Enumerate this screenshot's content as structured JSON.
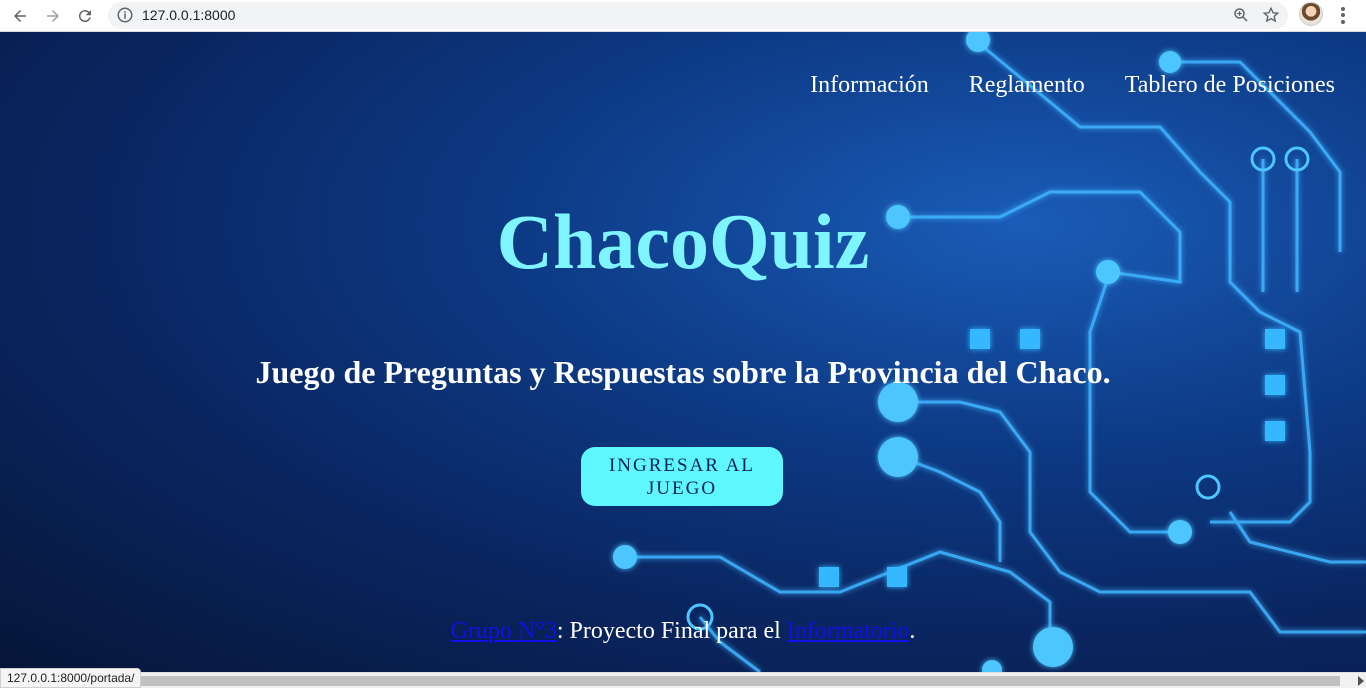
{
  "browser": {
    "url": "127.0.0.1:8000",
    "status_url": "127.0.0.1:8000/portada/"
  },
  "nav": {
    "items": [
      {
        "label": "Información"
      },
      {
        "label": "Reglamento"
      },
      {
        "label": "Tablero de Posiciones"
      }
    ]
  },
  "hero": {
    "title": "ChacoQuiz",
    "subtitle": "Juego de Preguntas y Respuestas sobre la Provincia del Chaco.",
    "cta_label": "INGRESAR AL JUEGO"
  },
  "footer": {
    "link1": "Grupo N°3",
    "text1": ": Proyecto Final para el ",
    "link2": "Informatorio",
    "text2": "."
  },
  "colors": {
    "title": "#7ff5ff",
    "cta_bg": "#5ef6ff",
    "link": "#1010e8",
    "circuit": "#3fb4ff"
  }
}
